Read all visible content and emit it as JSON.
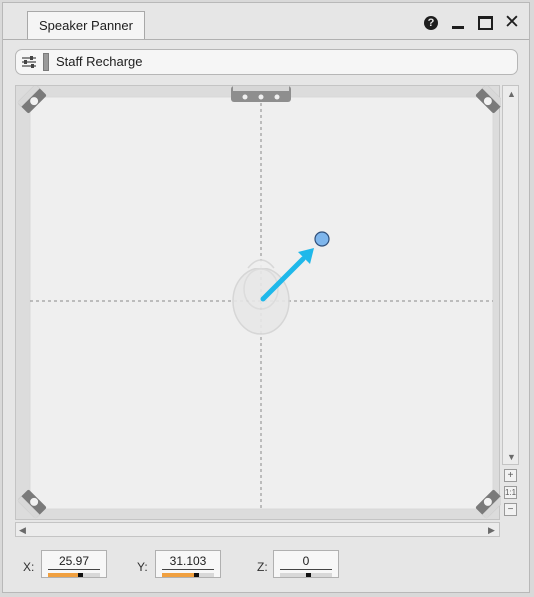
{
  "window": {
    "tab_title": "Speaker Panner",
    "help_icon": "help-circle-icon",
    "minimize_icon": "minimize-icon",
    "maximize_icon": "maximize-icon",
    "close_icon": "close-icon"
  },
  "event_bar": {
    "settings_icon": "sliders-icon",
    "event_name": "Staff Recharge"
  },
  "panner": {
    "listener_icon": "listener-head-icon",
    "speakers": [
      "front-left-speaker-icon",
      "center-speaker-icon",
      "front-right-speaker-icon",
      "rear-left-speaker-icon",
      "rear-right-speaker-icon"
    ],
    "arrow_color": "#1fb8ea",
    "emitter_color": "#7fb6ec"
  },
  "zoom": {
    "in": "+",
    "reset": "1:1",
    "out": "−"
  },
  "coords": {
    "x_label": "X:",
    "x_value": "25.97",
    "y_label": "Y:",
    "y_value": "31.103",
    "z_label": "Z:",
    "z_value": "0"
  }
}
